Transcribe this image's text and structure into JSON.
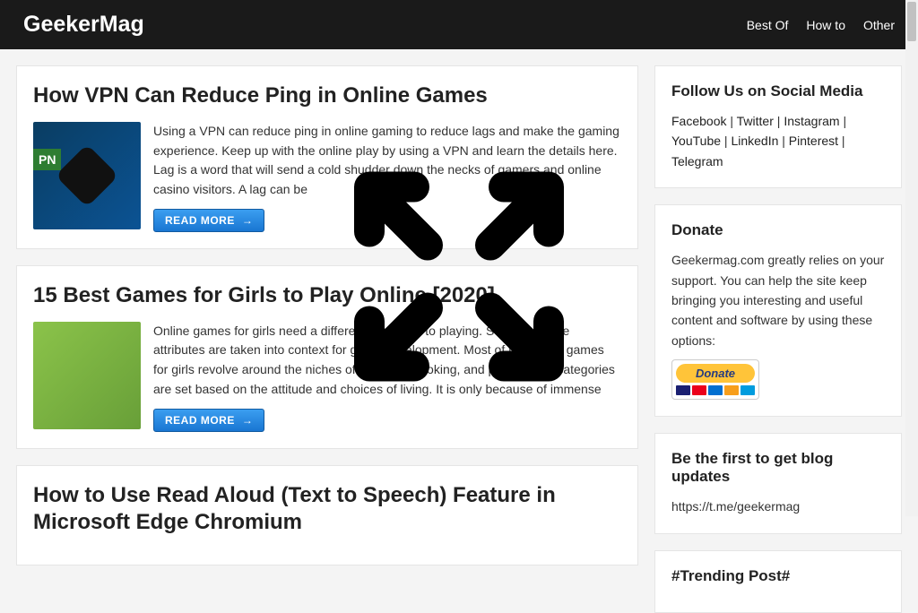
{
  "header": {
    "logo": "GeekerMag",
    "nav": [
      {
        "label": "Best Of"
      },
      {
        "label": "How to"
      },
      {
        "label": "Other"
      }
    ]
  },
  "posts": [
    {
      "title": "How VPN Can Reduce Ping in Online Games",
      "excerpt": "Using a VPN can reduce ping in online gaming to reduce lags and make the gaming experience. Keep up with the online play by using a VPN and learn the details here. Lag is a word that will send a cold shudder down the necks of gamers and online casino visitors. A lag can be",
      "readmore": "READ MORE"
    },
    {
      "title": "15 Best Games for Girls to Play Online [2020]",
      "excerpt": "Online games for girls need a different approach to playing. Some feminine attributes are taken into context for game development. Most of the online games for girls revolve around the niches of dressing, cooking, and pets. These categories are set based on the attitude and choices of living. It is only because of immense",
      "readmore": "READ MORE"
    },
    {
      "title": "How to Use Read Aloud (Text to Speech) Feature in Microsoft Edge Chromium"
    }
  ],
  "sidebar": {
    "follow": {
      "title": "Follow Us on Social Media",
      "links": [
        "Facebook",
        "Twitter",
        "Instagram",
        "YouTube",
        "LinkedIn",
        "Pinterest",
        "Telegram"
      ]
    },
    "donate": {
      "title": "Donate",
      "text": "Geekermag.com greatly relies on your support. You can help the site keep bringing you interesting and useful content and software by using these options:",
      "button": "Donate"
    },
    "blog_updates": {
      "title": "Be the first to get blog updates",
      "text": "https://t.me/geekermag"
    },
    "trending": {
      "title": "#Trending Post#"
    }
  }
}
